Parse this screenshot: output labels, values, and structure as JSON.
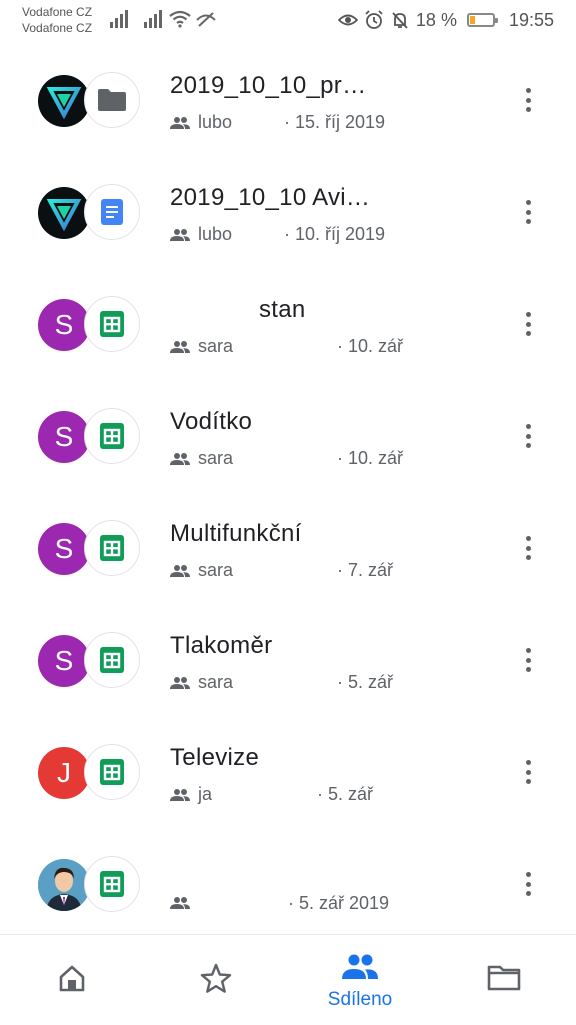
{
  "status": {
    "carrier1": "Vodafone CZ",
    "carrier2": "Vodafone CZ",
    "battery": "18 %",
    "time": "19:55"
  },
  "files": [
    {
      "title": "2019_10_10_pr…",
      "owner": "lubo",
      "date": "· 15. říj 2019",
      "type": "folder",
      "avatar": "logo"
    },
    {
      "title": "2019_10_10 Avi…",
      "owner": "lubo",
      "date": "· 10. říj 2019",
      "type": "docs",
      "avatar": "logo"
    },
    {
      "title": "stan",
      "owner": "sara",
      "date": "· 10. zář",
      "type": "sheets",
      "avatar": "S"
    },
    {
      "title": "Vodítko",
      "owner": "sara",
      "date": "· 10. zář",
      "type": "sheets",
      "avatar": "S"
    },
    {
      "title": "Multifunkční",
      "owner": "sara",
      "date": "· 7. zář",
      "type": "sheets",
      "avatar": "S"
    },
    {
      "title": "Tlakoměr",
      "owner": "sara",
      "date": "· 5. zář",
      "type": "sheets",
      "avatar": "S"
    },
    {
      "title": "Televize",
      "owner": "ja",
      "date": "· 5. zář",
      "type": "sheets",
      "avatar": "J"
    },
    {
      "title": "",
      "owner": "",
      "date": "· 5. zář 2019",
      "type": "sheets",
      "avatar": "person-photo"
    }
  ],
  "nav": {
    "home": "home-icon",
    "starred": "star-icon",
    "shared_label": "Sdíleno",
    "files": "folder-icon"
  },
  "colors": {
    "accent": "#1a73e8",
    "avatar_s": "#9c27b0",
    "avatar_j": "#e53935",
    "sheets": "#0f9d58",
    "docs": "#4285f4",
    "folder": "#5f6368"
  }
}
